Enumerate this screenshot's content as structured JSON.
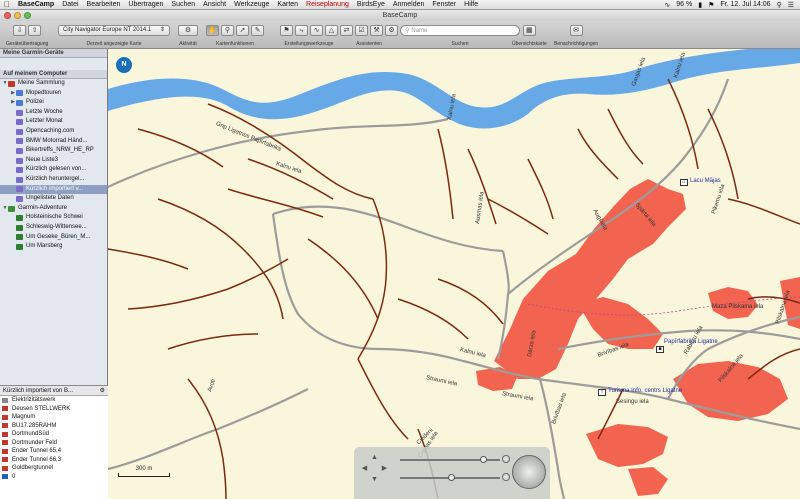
{
  "menubar": {
    "app_name": "BaseCamp",
    "items": [
      "Datei",
      "Bearbeiten",
      "Übertragen",
      "Suchen",
      "Ansicht",
      "Werkzeuge",
      "Karten",
      "Reiseplanung",
      "BirdsEye",
      "Anmelden",
      "Fenster",
      "Hilfe"
    ],
    "active_item": "Reiseplanung",
    "battery": "96 %",
    "clock": "Fr. 12. Jul  14:06"
  },
  "window": {
    "title": "BaseCamp"
  },
  "toolbar": {
    "map_select": "City Navigator Europe NT 2014.1",
    "search_placeholder": "Name",
    "labels": {
      "transfer": "Geräteübertragung",
      "current_map": "Derzeit angezeigte Karte",
      "activity": "Aktivität",
      "map_functions": "Kartenfunktionen",
      "creation_tools": "Erstellungswerkzeuge",
      "assistants": "Assistenten",
      "search": "Suchen",
      "overview": "Übersichtskarte",
      "notifications": "Benachrichtigungen"
    }
  },
  "sidebar": {
    "devices_header": "Meine Garmin-Geräte",
    "computer_header": "Auf meinem Computer",
    "tree": [
      {
        "label": "Meine Sammlung",
        "level": 0,
        "color": "#c0392b",
        "expanded": true
      },
      {
        "label": "Mopedtouren",
        "level": 1,
        "color": "#4a7bd0",
        "expanded": false
      },
      {
        "label": "Polizei",
        "level": 1,
        "color": "#4a7bd0",
        "expanded": false
      },
      {
        "label": "Letzte Woche",
        "level": 1,
        "color": "#7a6dc8"
      },
      {
        "label": "Letzter Monat",
        "level": 1,
        "color": "#7a6dc8"
      },
      {
        "label": "Opencaching.com",
        "level": 1,
        "color": "#7a6dc8"
      },
      {
        "label": "BMW Motorrad Händ...",
        "level": 1,
        "color": "#7a6dc8"
      },
      {
        "label": "Bikertreffs_NRW_HE_RP",
        "level": 1,
        "color": "#7a6dc8"
      },
      {
        "label": "Neue Liste3",
        "level": 1,
        "color": "#7a6dc8"
      },
      {
        "label": "Kürzlich gelesen von...",
        "level": 1,
        "color": "#7a6dc8"
      },
      {
        "label": "Kürzlich heruntergel...",
        "level": 1,
        "color": "#7a6dc8"
      },
      {
        "label": "Kürzlich importiert v...",
        "level": 1,
        "color": "#7a6dc8",
        "selected": true
      },
      {
        "label": "Ungelistete Daten",
        "level": 1,
        "color": "#7a6dc8"
      },
      {
        "label": "Garmin-Adventure",
        "level": 0,
        "color": "#3f8f3a",
        "expanded": true
      },
      {
        "label": "Holsteinische Schwei",
        "level": 1,
        "color": "#2e7d32"
      },
      {
        "label": "Schleswig-Wittensee...",
        "level": 1,
        "color": "#2e7d32"
      },
      {
        "label": "Um Geseke_Büren_M...",
        "level": 1,
        "color": "#2e7d32"
      },
      {
        "label": "Um Marsberg",
        "level": 1,
        "color": "#2e7d32"
      }
    ],
    "list_header": "Kürzlich importiert von B...",
    "waypoints": [
      {
        "label": "Elektrizitätswerk",
        "icon": "#888888"
      },
      {
        "label": "Deusen STELLWERK",
        "icon": "#c0392b"
      },
      {
        "label": "Magnum",
        "icon": "#c0392b"
      },
      {
        "label": "BÜ17.285RAHM",
        "icon": "#c0392b"
      },
      {
        "label": "DortmundSüd",
        "icon": "#c0392b"
      },
      {
        "label": "Dortmunder Feld",
        "icon": "#c0392b"
      },
      {
        "label": "Ender Tunnel 65,4",
        "icon": "#c0392b"
      },
      {
        "label": "Ender Tunnel 66,3",
        "icon": "#c0392b"
      },
      {
        "label": "Goldbergtunnel",
        "icon": "#c0392b"
      },
      {
        "label": "0",
        "icon": "#1f5fbf"
      }
    ]
  },
  "map": {
    "road_labels": [
      "Gnp Ligatnes Papīrfabrika",
      "Kalnu iela",
      "Kalnu iela",
      "Ausmas iela",
      "Gaujas iela",
      "Kalnu iela",
      "Augšiela",
      "Spārta iela",
      "Pikemu iela",
      "Maza Pilskalna iela",
      "Pilskalna iela",
      "Kalnu iela",
      "Dārza iela",
      "Brivības iela",
      "Straumi iela",
      "Straumi iela",
      "Brivības iela",
      "Rabezu iela",
      "Pilskalna iela",
      "Avoti",
      "Gaujas iela",
      "Ciedeni",
      "Spīrgu iela"
    ],
    "pois": [
      "Lacu Mājas",
      "Papīrfabrika Ligatne",
      "Turisma Info. centrs Ligatne",
      "Sesingu iela"
    ],
    "scale_label": "300 m",
    "compass_label": "N",
    "colors": {
      "land": "#faf6dc",
      "river": "#66a9e6",
      "urban": "#f26450",
      "track": "#7a2a10",
      "road": "#9c9c9c"
    }
  }
}
